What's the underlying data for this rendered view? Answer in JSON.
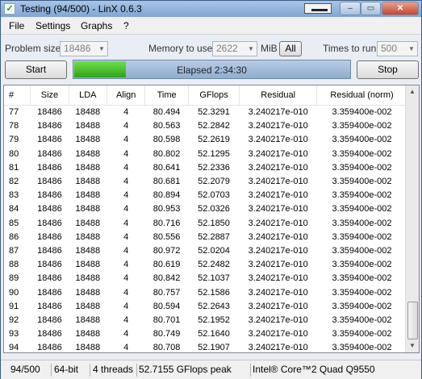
{
  "window": {
    "title": "Testing (94/500) - LinX 0.6.3",
    "icon": "checkmark-app-icon",
    "min_label": "–",
    "max_label": "▭",
    "close_label": "✕"
  },
  "menu": [
    "File",
    "Settings",
    "Graphs",
    "?"
  ],
  "controls": {
    "problem_size_label": "Problem size:",
    "problem_size_value": "18486",
    "memory_label": "Memory to use:",
    "memory_value": "2622",
    "memory_unit": "MiB",
    "all_label": "All",
    "times_label": "Times to run:",
    "times_value": "500",
    "start_label": "Start",
    "stop_label": "Stop",
    "progress_fraction": 0.188,
    "elapsed_text": "Elapsed 2:34:30"
  },
  "table": {
    "columns": [
      "#",
      "Size",
      "LDA",
      "Align",
      "Time",
      "GFlops",
      "Residual",
      "Residual (norm)"
    ],
    "rows": [
      [
        "77",
        "18486",
        "18488",
        "4",
        "80.494",
        "52.3291",
        "3.240217e-010",
        "3.359400e-002"
      ],
      [
        "78",
        "18486",
        "18488",
        "4",
        "80.563",
        "52.2842",
        "3.240217e-010",
        "3.359400e-002"
      ],
      [
        "79",
        "18486",
        "18488",
        "4",
        "80.598",
        "52.2619",
        "3.240217e-010",
        "3.359400e-002"
      ],
      [
        "80",
        "18486",
        "18488",
        "4",
        "80.802",
        "52.1295",
        "3.240217e-010",
        "3.359400e-002"
      ],
      [
        "81",
        "18486",
        "18488",
        "4",
        "80.641",
        "52.2336",
        "3.240217e-010",
        "3.359400e-002"
      ],
      [
        "82",
        "18486",
        "18488",
        "4",
        "80.681",
        "52.2079",
        "3.240217e-010",
        "3.359400e-002"
      ],
      [
        "83",
        "18486",
        "18488",
        "4",
        "80.894",
        "52.0703",
        "3.240217e-010",
        "3.359400e-002"
      ],
      [
        "84",
        "18486",
        "18488",
        "4",
        "80.953",
        "52.0326",
        "3.240217e-010",
        "3.359400e-002"
      ],
      [
        "85",
        "18486",
        "18488",
        "4",
        "80.716",
        "52.1850",
        "3.240217e-010",
        "3.359400e-002"
      ],
      [
        "86",
        "18486",
        "18488",
        "4",
        "80.556",
        "52.2887",
        "3.240217e-010",
        "3.359400e-002"
      ],
      [
        "87",
        "18486",
        "18488",
        "4",
        "80.972",
        "52.0204",
        "3.240217e-010",
        "3.359400e-002"
      ],
      [
        "88",
        "18486",
        "18488",
        "4",
        "80.619",
        "52.2482",
        "3.240217e-010",
        "3.359400e-002"
      ],
      [
        "89",
        "18486",
        "18488",
        "4",
        "80.842",
        "52.1037",
        "3.240217e-010",
        "3.359400e-002"
      ],
      [
        "90",
        "18486",
        "18488",
        "4",
        "80.757",
        "52.1586",
        "3.240217e-010",
        "3.359400e-002"
      ],
      [
        "91",
        "18486",
        "18488",
        "4",
        "80.594",
        "52.2643",
        "3.240217e-010",
        "3.359400e-002"
      ],
      [
        "92",
        "18486",
        "18488",
        "4",
        "80.701",
        "52.1952",
        "3.240217e-010",
        "3.359400e-002"
      ],
      [
        "93",
        "18486",
        "18488",
        "4",
        "80.749",
        "52.1640",
        "3.240217e-010",
        "3.359400e-002"
      ],
      [
        "94",
        "18486",
        "18488",
        "4",
        "80.708",
        "52.1907",
        "3.240217e-010",
        "3.359400e-002"
      ]
    ]
  },
  "status": {
    "progress": "94/500",
    "bits": "64-bit",
    "threads": "4 threads",
    "peak": "52.7155 GFlops peak",
    "cpu": "Intel® Core™2 Quad Q9550"
  },
  "colors": {
    "progress_fill": "#3dbb27",
    "close_button": "#c6462e"
  }
}
